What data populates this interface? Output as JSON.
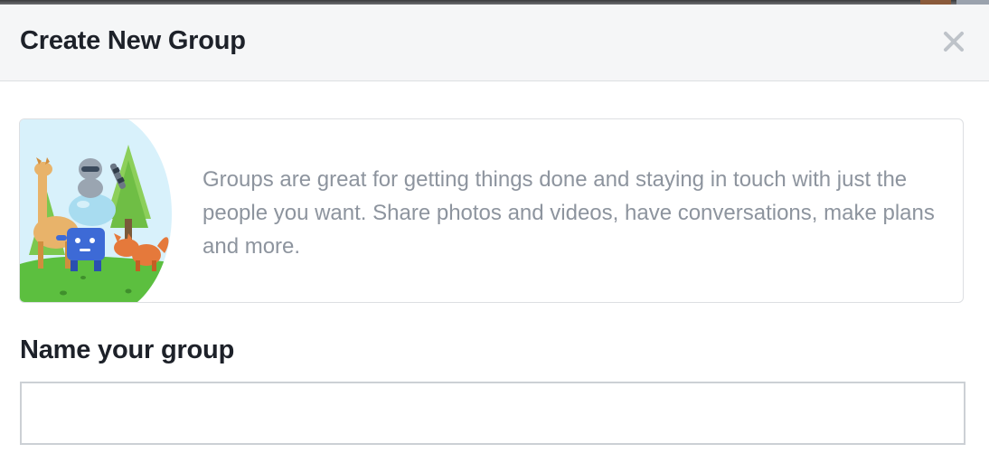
{
  "dialog": {
    "title": "Create New Group",
    "close_icon": "close-icon"
  },
  "info": {
    "text": "Groups are great for getting things done and staying in touch with just the people you want. Share photos and videos, have conversations, make plans and more.",
    "illustration": "group-animals-illustration"
  },
  "name_field": {
    "label": "Name your group",
    "value": "",
    "placeholder": ""
  },
  "colors": {
    "title_text": "#1d2129",
    "secondary_text": "#8d949e",
    "header_bg": "#f5f6f7",
    "border": "#dddfe2"
  }
}
